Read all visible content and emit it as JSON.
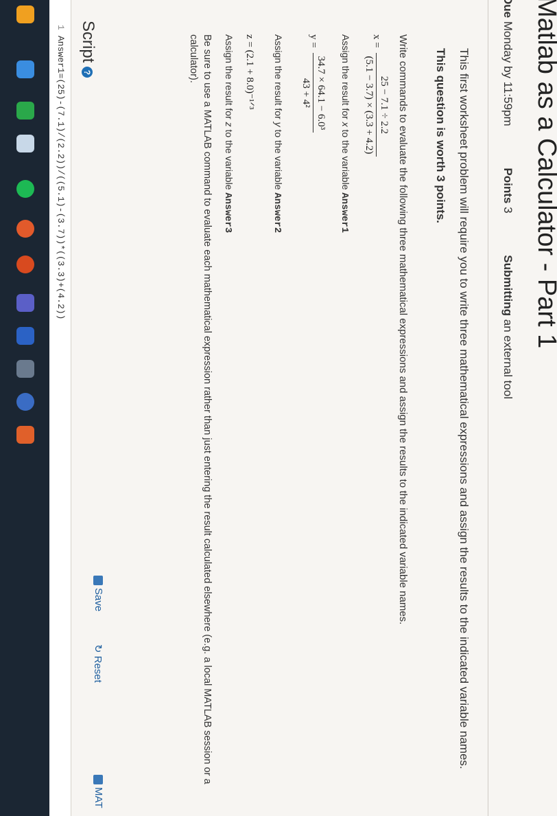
{
  "page": {
    "title": "Matlab as a Calculator - Part 1"
  },
  "meta": {
    "due_label": "Due",
    "due_value": "Monday by 11:59pm",
    "points_label": "Points",
    "points_value": "3",
    "submitting_label": "Submitting",
    "submitting_value": "an external tool"
  },
  "description": {
    "intro": "This first worksheet problem will require you to write three mathematical expressions and assign the results to the indicated variable names.",
    "worth": "This question is worth 3 points.",
    "command": "Write commands to evaluate the following three mathematical expressions and assign the results to the indicated variable names.",
    "expr_x_lhs": "x =",
    "expr_x_num": "25 − 7.1 ÷ 2.2",
    "expr_x_den": "(5.1 − 3.7) × (3.3 + 4.2)",
    "assign_x_prefix": "Assign the result for",
    "assign_x_var": "x",
    "assign_x_mid": "to the variable",
    "assign_x_target": "Answer1",
    "expr_y_lhs": "y =",
    "expr_y_num": "34.7 × 64.1 − 6.0³",
    "expr_y_den": "43 + 4²",
    "assign_y_prefix": "Assign the result for",
    "assign_y_var": "y",
    "assign_y_mid": "to the variable",
    "assign_y_target": "Answer2",
    "expr_z": "z = (2.1 + 8.0)⁻¹ᐟ³",
    "assign_z_prefix": "Assign the result for",
    "assign_z_var": "z",
    "assign_z_mid": "to the variable",
    "assign_z_target": "Answer3",
    "note": "Be sure to use a MATLAB command to evaluate each mathematical expression rather than just entering the result calculated elsewhere (e.g. a local MATLAB session or a calculator)."
  },
  "script": {
    "label": "Script",
    "help_icon": "?",
    "save_label": "Save",
    "reset_label": "Reset",
    "mat_label": "MAT",
    "line_number": "1",
    "code_line": "Answer1=(25)-(7.1)/(2.2))/((5.1)-(3.7))*((3.3)+(4.2))"
  },
  "taskbar": {
    "icons": [
      "file-icon",
      "app-icon",
      "chat-icon",
      "browser-icon",
      "spotify-icon",
      "chrome-icon",
      "settings-icon",
      "teams-icon",
      "word-icon",
      "calculator-icon",
      "store-icon",
      "app-icon"
    ]
  }
}
